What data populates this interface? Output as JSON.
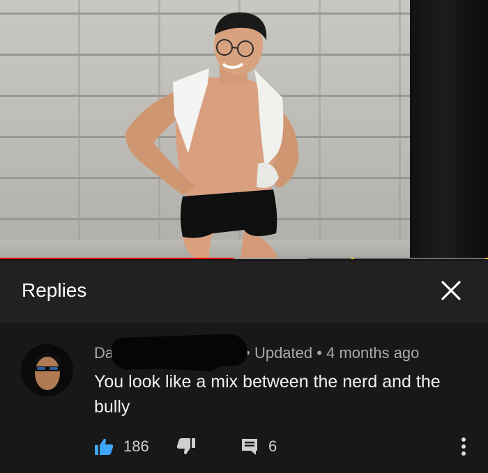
{
  "video": {
    "progress_played_fraction": 0.48,
    "progress_buffered_fraction": 0.63,
    "ad_marker_fractions": [
      0.72,
      0.995
    ]
  },
  "replies_panel": {
    "title": "Replies",
    "close_icon": "close-icon"
  },
  "comment": {
    "author_visible": "Da",
    "meta_separator": "•",
    "status": "Updated",
    "time_ago": "4 months ago",
    "text": "You look like a mix between the nerd and the bully",
    "likes": "186",
    "replies": "6",
    "icons": {
      "like": "thumbs-up-icon",
      "dislike": "thumbs-down-icon",
      "reply": "comment-icon",
      "more": "more-vert-icon"
    },
    "colors": {
      "like_active": "#3ea6ff",
      "meta_text": "#aaaaaa"
    }
  },
  "colors": {
    "background": "#181818",
    "header_background": "#212121",
    "progress_red": "#ff0000",
    "ad_marker": "#f2c300"
  }
}
